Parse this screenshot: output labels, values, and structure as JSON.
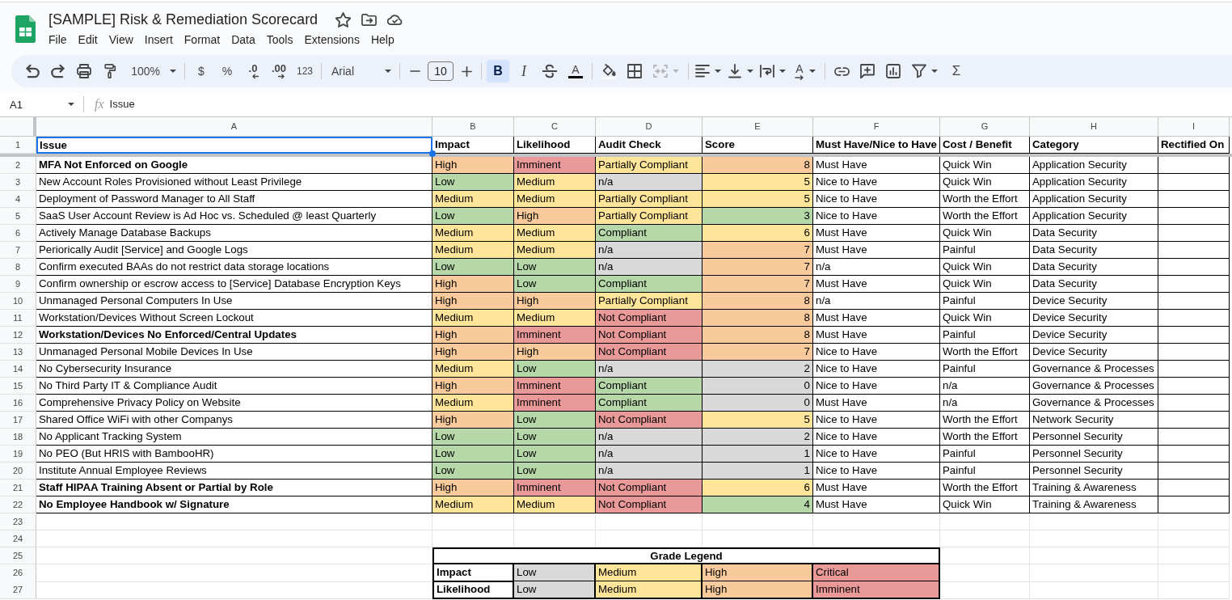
{
  "window": {
    "title": "[SAMPLE] Risk & Remediation Scorecard"
  },
  "menu": [
    "File",
    "Edit",
    "View",
    "Insert",
    "Format",
    "Data",
    "Tools",
    "Extensions",
    "Help"
  ],
  "toolbar": {
    "zoom": "100%",
    "number_formats": [
      {
        "label": "$",
        "kind": "currency"
      },
      {
        "label": "%",
        "kind": "percent"
      },
      {
        "label": ".0",
        "kind": "decrease"
      },
      {
        "label": ".00",
        "kind": "increase"
      },
      {
        "label": "123",
        "kind": "number"
      }
    ],
    "font": "Arial",
    "font_size": "10",
    "styles": [
      {
        "label": "B",
        "kind": "bold",
        "on": true
      },
      {
        "label": "I",
        "kind": "italic",
        "on": false
      }
    ],
    "text_color": "A",
    "merge": {
      "disabled": true
    },
    "text_rotation": "A",
    "functions": "Σ"
  },
  "formula_bar": {
    "name_box": "A1",
    "function_label": "fx",
    "formula": "Issue"
  },
  "sheet": {
    "column_letters": [
      "A",
      "B",
      "C",
      "D",
      "E",
      "F",
      "G",
      "H",
      "I"
    ],
    "row_numbers": [
      "1",
      "2",
      "3",
      "4",
      "5",
      "6",
      "7",
      "8",
      "9",
      "10",
      "11",
      "12",
      "13",
      "14",
      "15",
      "16",
      "17",
      "18",
      "19",
      "20",
      "21",
      "22",
      "23",
      "24",
      "25",
      "26",
      "27"
    ],
    "columns": [
      {
        "label": "Issue",
        "selected": true
      },
      {
        "label": "Impact",
        "selected": false
      },
      {
        "label": "Likelihood",
        "selected": false
      },
      {
        "label": "Audit Check",
        "selected": false
      },
      {
        "label": "Score",
        "selected": false
      },
      {
        "label": "Must Have/Nice to Have",
        "selected": false
      },
      {
        "label": "Cost / Benefit",
        "selected": false
      },
      {
        "label": "Category",
        "selected": false
      },
      {
        "label": "Rectified On",
        "selected": false
      }
    ],
    "rows": [
      {
        "issue": "MFA Not Enforced on Google",
        "bold": true,
        "impact": {
          "text": "High",
          "color": "#f9cb9c"
        },
        "likelihood": {
          "text": "Imminent",
          "color": "#ea9999"
        },
        "audit_check": {
          "text": "Partially Compliant",
          "color": "#ffe599"
        },
        "score": {
          "text": "8",
          "color": "#f9cb9c"
        },
        "priority": "Must Have",
        "cost_benefit": "Quick Win",
        "category": "Application Security"
      },
      {
        "issue": "New Account Roles Provisioned without Least Privilege",
        "bold": false,
        "impact": {
          "text": "Low",
          "color": "#b6d7a8"
        },
        "likelihood": {
          "text": "Medium",
          "color": "#ffe599"
        },
        "audit_check": {
          "text": "n/a",
          "color": "#d9d9d9"
        },
        "score": {
          "text": "5",
          "color": "#ffe599"
        },
        "priority": "Nice to Have",
        "cost_benefit": "Quick Win",
        "category": "Application Security"
      },
      {
        "issue": "Deployment of Password Manager to All Staff",
        "bold": false,
        "impact": {
          "text": "Medium",
          "color": "#ffe599"
        },
        "likelihood": {
          "text": "Medium",
          "color": "#ffe599"
        },
        "audit_check": {
          "text": "Partially Compliant",
          "color": "#ffe599"
        },
        "score": {
          "text": "5",
          "color": "#ffe599"
        },
        "priority": "Nice to Have",
        "cost_benefit": "Worth the Effort",
        "category": "Application Security"
      },
      {
        "issue": "SaaS User Account Review is Ad Hoc vs. Scheduled @ least Quarterly",
        "bold": false,
        "impact": {
          "text": "Low",
          "color": "#b6d7a8"
        },
        "likelihood": {
          "text": "High",
          "color": "#f9cb9c"
        },
        "audit_check": {
          "text": "Partially Compliant",
          "color": "#ffe599"
        },
        "score": {
          "text": "3",
          "color": "#b6d7a8"
        },
        "priority": "Nice to Have",
        "cost_benefit": "Worth the Effort",
        "category": "Application Security"
      },
      {
        "issue": "Actively Manage Database Backups",
        "bold": false,
        "impact": {
          "text": "Medium",
          "color": "#ffe599"
        },
        "likelihood": {
          "text": "Medium",
          "color": "#ffe599"
        },
        "audit_check": {
          "text": "Compliant",
          "color": "#b6d7a8"
        },
        "score": {
          "text": "6",
          "color": "#ffe599"
        },
        "priority": "Must Have",
        "cost_benefit": "Quick Win",
        "category": "Data Security"
      },
      {
        "issue": "Periorically Audit [Service] and Google Logs",
        "bold": false,
        "impact": {
          "text": "Medium",
          "color": "#ffe599"
        },
        "likelihood": {
          "text": "Medium",
          "color": "#ffe599"
        },
        "audit_check": {
          "text": "n/a",
          "color": "#d9d9d9"
        },
        "score": {
          "text": "7",
          "color": "#f9cb9c"
        },
        "priority": "Must Have",
        "cost_benefit": "Painful",
        "category": "Data Security"
      },
      {
        "issue": "Confirm executed BAAs do not restrict data storage locations",
        "bold": false,
        "impact": {
          "text": "Low",
          "color": "#b6d7a8"
        },
        "likelihood": {
          "text": "Low",
          "color": "#b6d7a8"
        },
        "audit_check": {
          "text": "n/a",
          "color": "#d9d9d9"
        },
        "score": {
          "text": "7",
          "color": "#f9cb9c"
        },
        "priority": "n/a",
        "cost_benefit": "Quick Win",
        "category": "Data Security"
      },
      {
        "issue": "Confirm ownership or escrow access to [Service] Database Encryption Keys",
        "bold": false,
        "impact": {
          "text": "High",
          "color": "#f9cb9c"
        },
        "likelihood": {
          "text": "Low",
          "color": "#b6d7a8"
        },
        "audit_check": {
          "text": "Compliant",
          "color": "#b6d7a8"
        },
        "score": {
          "text": "7",
          "color": "#f9cb9c"
        },
        "priority": "Must Have",
        "cost_benefit": "Quick Win",
        "category": "Data Security"
      },
      {
        "issue": "Unmanaged Personal Computers In Use",
        "bold": false,
        "impact": {
          "text": "High",
          "color": "#f9cb9c"
        },
        "likelihood": {
          "text": "High",
          "color": "#f9cb9c"
        },
        "audit_check": {
          "text": "Partially Compliant",
          "color": "#ffe599"
        },
        "score": {
          "text": "8",
          "color": "#f9cb9c"
        },
        "priority": "n/a",
        "cost_benefit": "Painful",
        "category": "Device Security"
      },
      {
        "issue": "Workstation/Devices Without Screen Lockout",
        "bold": false,
        "impact": {
          "text": "Medium",
          "color": "#ffe599"
        },
        "likelihood": {
          "text": "Medium",
          "color": "#ffe599"
        },
        "audit_check": {
          "text": "Not Compliant",
          "color": "#ea9999"
        },
        "score": {
          "text": "8",
          "color": "#f9cb9c"
        },
        "priority": "Must Have",
        "cost_benefit": "Quick Win",
        "category": "Device Security"
      },
      {
        "issue": "Workstation/Devices No Enforced/Central Updates",
        "bold": true,
        "impact": {
          "text": "High",
          "color": "#f9cb9c"
        },
        "likelihood": {
          "text": "Imminent",
          "color": "#ea9999"
        },
        "audit_check": {
          "text": "Not Compliant",
          "color": "#ea9999"
        },
        "score": {
          "text": "8",
          "color": "#f9cb9c"
        },
        "priority": "Must Have",
        "cost_benefit": "Painful",
        "category": "Device Security"
      },
      {
        "issue": "Unmanaged Personal Mobile Devices In Use",
        "bold": false,
        "impact": {
          "text": "High",
          "color": "#f9cb9c"
        },
        "likelihood": {
          "text": "High",
          "color": "#f9cb9c"
        },
        "audit_check": {
          "text": "Not Compliant",
          "color": "#ea9999"
        },
        "score": {
          "text": "7",
          "color": "#f9cb9c"
        },
        "priority": "Nice to Have",
        "cost_benefit": "Worth the Effort",
        "category": "Device Security"
      },
      {
        "issue": "No Cybersecurity Insurance",
        "bold": false,
        "impact": {
          "text": "Medium",
          "color": "#ffe599"
        },
        "likelihood": {
          "text": "Low",
          "color": "#b6d7a8"
        },
        "audit_check": {
          "text": "n/a",
          "color": "#d9d9d9"
        },
        "score": {
          "text": "2",
          "color": "#d9d9d9"
        },
        "priority": "Nice to Have",
        "cost_benefit": "Painful",
        "category": "Governance & Processes"
      },
      {
        "issue": "No Third Party IT & Compliance Audit",
        "bold": false,
        "impact": {
          "text": "High",
          "color": "#f9cb9c"
        },
        "likelihood": {
          "text": "Imminent",
          "color": "#ea9999"
        },
        "audit_check": {
          "text": "Compliant",
          "color": "#b6d7a8"
        },
        "score": {
          "text": "0",
          "color": "#d9d9d9"
        },
        "priority": "Nice to Have",
        "cost_benefit": "n/a",
        "category": "Governance & Processes"
      },
      {
        "issue": "Comprehensive Privacy Policy on Website",
        "bold": false,
        "impact": {
          "text": "Medium",
          "color": "#ffe599"
        },
        "likelihood": {
          "text": "Imminent",
          "color": "#ea9999"
        },
        "audit_check": {
          "text": "Compliant",
          "color": "#b6d7a8"
        },
        "score": {
          "text": "0",
          "color": "#d9d9d9"
        },
        "priority": "Must Have",
        "cost_benefit": "n/a",
        "category": "Governance & Processes"
      },
      {
        "issue": "Shared Office WiFi with other Companys",
        "bold": false,
        "impact": {
          "text": "High",
          "color": "#f9cb9c"
        },
        "likelihood": {
          "text": "Low",
          "color": "#b6d7a8"
        },
        "audit_check": {
          "text": "Not Compliant",
          "color": "#ea9999"
        },
        "score": {
          "text": "5",
          "color": "#ffe599"
        },
        "priority": "Nice to Have",
        "cost_benefit": "Worth the Effort",
        "category": "Network Security"
      },
      {
        "issue": "No Applicant Tracking System",
        "bold": false,
        "impact": {
          "text": "Low",
          "color": "#b6d7a8"
        },
        "likelihood": {
          "text": "Low",
          "color": "#b6d7a8"
        },
        "audit_check": {
          "text": "n/a",
          "color": "#d9d9d9"
        },
        "score": {
          "text": "2",
          "color": "#d9d9d9"
        },
        "priority": "Nice to Have",
        "cost_benefit": "Worth the Effort",
        "category": "Personnel Security"
      },
      {
        "issue": "No PEO (But HRIS with BambooHR)",
        "bold": false,
        "impact": {
          "text": "Low",
          "color": "#b6d7a8"
        },
        "likelihood": {
          "text": "Low",
          "color": "#b6d7a8"
        },
        "audit_check": {
          "text": "n/a",
          "color": "#d9d9d9"
        },
        "score": {
          "text": "1",
          "color": "#d9d9d9"
        },
        "priority": "Nice to Have",
        "cost_benefit": "Painful",
        "category": "Personnel Security"
      },
      {
        "issue": "Institute Annual Employee Reviews",
        "bold": false,
        "impact": {
          "text": "Low",
          "color": "#b6d7a8"
        },
        "likelihood": {
          "text": "Low",
          "color": "#b6d7a8"
        },
        "audit_check": {
          "text": "n/a",
          "color": "#d9d9d9"
        },
        "score": {
          "text": "1",
          "color": "#d9d9d9"
        },
        "priority": "Nice to Have",
        "cost_benefit": "Painful",
        "category": "Personnel Security"
      },
      {
        "issue": "Staff HIPAA Training Absent or Partial by Role",
        "bold": true,
        "impact": {
          "text": "High",
          "color": "#f9cb9c"
        },
        "likelihood": {
          "text": "Imminent",
          "color": "#ea9999"
        },
        "audit_check": {
          "text": "Not Compliant",
          "color": "#ea9999"
        },
        "score": {
          "text": "6",
          "color": "#ffe599"
        },
        "priority": "Must Have",
        "cost_benefit": "Worth the Effort",
        "category": "Training & Awareness"
      },
      {
        "issue": "No Employee Handbook w/ Signature",
        "bold": true,
        "impact": {
          "text": "Medium",
          "color": "#ffe599"
        },
        "likelihood": {
          "text": "Medium",
          "color": "#ffe599"
        },
        "audit_check": {
          "text": "Not Compliant",
          "color": "#ea9999"
        },
        "score": {
          "text": "4",
          "color": "#b6d7a8"
        },
        "priority": "Must Have",
        "cost_benefit": "Quick Win",
        "category": "Training & Awareness"
      }
    ],
    "legend": {
      "title": "Grade Legend",
      "rows": [
        {
          "label": "Impact",
          "grades": [
            {
              "text": "Low",
              "color": "#d9d9d9"
            },
            {
              "text": "Medium",
              "color": "#ffe599"
            },
            {
              "text": "High",
              "color": "#f9cb9c"
            },
            {
              "text": "Critical",
              "color": "#ea9999"
            }
          ]
        },
        {
          "label": "Likelihood",
          "grades": [
            {
              "text": "Low",
              "color": "#d9d9d9"
            },
            {
              "text": "Medium",
              "color": "#ffe599"
            },
            {
              "text": "High",
              "color": "#f9cb9c"
            },
            {
              "text": "Imminent",
              "color": "#ea9999"
            }
          ]
        }
      ]
    }
  }
}
